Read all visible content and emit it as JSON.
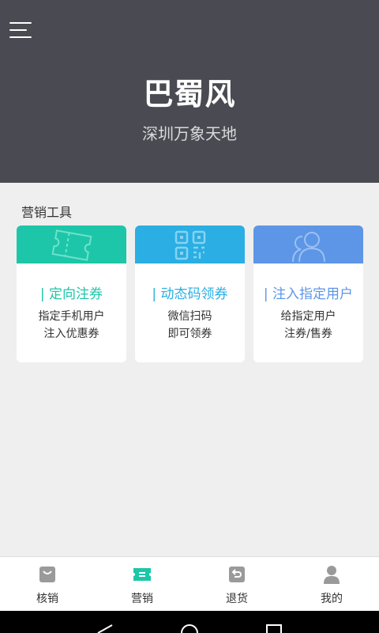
{
  "header": {
    "title": "巴蜀风",
    "subtitle": "深圳万象天地"
  },
  "section": {
    "title": "营销工具"
  },
  "cards": [
    {
      "title": "| 定向注券",
      "desc1": "指定手机用户",
      "desc2": "注入优惠券",
      "color": "#1dc6a8"
    },
    {
      "title": "| 动态码领券",
      "desc1": "微信扫码",
      "desc2": "即可领券",
      "color": "#2aaee3"
    },
    {
      "title": "| 注入指定用户",
      "desc1": "给指定用户",
      "desc2": "注券/售券",
      "color": "#5d96e6"
    }
  ],
  "tabs": [
    {
      "label": "核销",
      "icon": "bag-icon",
      "active": false
    },
    {
      "label": "营销",
      "icon": "ticket-icon",
      "active": true
    },
    {
      "label": "退货",
      "icon": "return-icon",
      "active": false
    },
    {
      "label": "我的",
      "icon": "user-icon",
      "active": false
    }
  ],
  "colors": {
    "header_bg": "#4a4a52",
    "active_tab": "#1dc6a8",
    "inactive_tab": "#9a9a9a"
  }
}
